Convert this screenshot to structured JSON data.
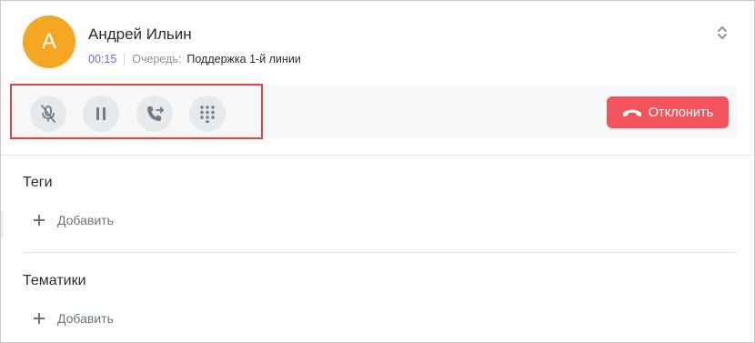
{
  "caller": {
    "avatar_letter": "А",
    "name": "Андрей Ильин",
    "timer": "00:15",
    "queue_label": "Очередь:",
    "queue_value": "Поддержка 1-й линии"
  },
  "controls": {
    "decline_label": "Отклонить",
    "icons": [
      "mic-off-icon",
      "pause-icon",
      "transfer-call-icon",
      "dialpad-icon",
      "hangup-icon",
      "expand-collapse-icon",
      "plus-icon"
    ]
  },
  "sections": {
    "tags": {
      "title": "Теги",
      "add_label": "Добавить"
    },
    "topics": {
      "title": "Тематики",
      "add_label": "Добавить"
    }
  },
  "colors": {
    "avatar": "#f5a623",
    "timer": "#7b5fd9",
    "decline": "#f2545b",
    "highlight": "#e3403f",
    "icon": "#6f7c88"
  }
}
